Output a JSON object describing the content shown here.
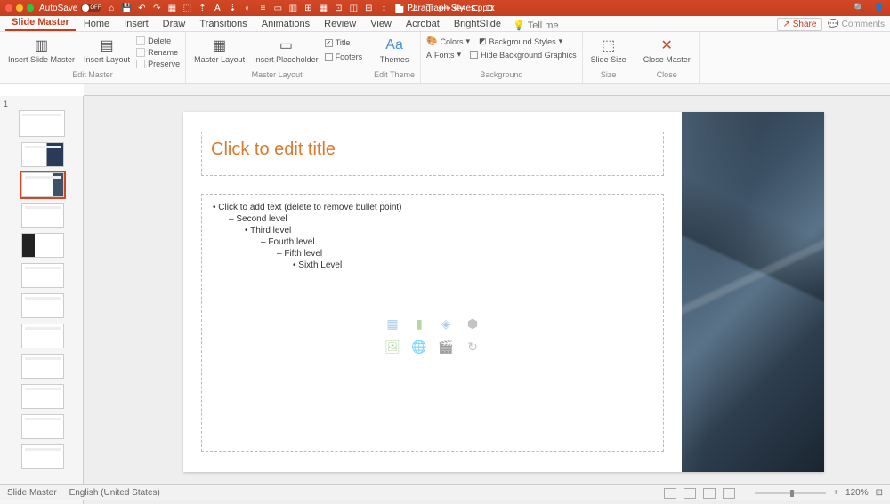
{
  "titlebar": {
    "autosave_label": "AutoSave",
    "autosave_state": "OFF",
    "filename": "Paragraph Styles.pptx"
  },
  "tabs": {
    "items": [
      "Slide Master",
      "Home",
      "Insert",
      "Draw",
      "Transitions",
      "Animations",
      "Review",
      "View",
      "Acrobat",
      "BrightSlide"
    ],
    "active": 0,
    "tellme": "Tell me",
    "share": "Share",
    "comments": "Comments"
  },
  "ribbon": {
    "edit_master": {
      "insert_slide_master": "Insert Slide Master",
      "insert_layout": "Insert Layout",
      "delete": "Delete",
      "rename": "Rename",
      "preserve": "Preserve",
      "group": "Edit Master"
    },
    "master_layout": {
      "master_layout": "Master Layout",
      "insert_placeholder": "Insert Placeholder",
      "title": "Title",
      "footers": "Footers",
      "group": "Master Layout"
    },
    "edit_theme": {
      "themes": "Themes",
      "group": "Edit Theme"
    },
    "background": {
      "colors": "Colors",
      "styles": "Background Styles",
      "fonts": "Fonts",
      "hide": "Hide Background Graphics",
      "group": "Background"
    },
    "size": {
      "slide_size": "Slide Size",
      "group": "Size"
    },
    "close": {
      "close_master": "Close Master",
      "group": "Close"
    }
  },
  "slide": {
    "title_placeholder": "Click to edit title",
    "body": {
      "l1": "Click to add text (delete to remove bullet point)",
      "l2": "Second level",
      "l3": "Third level",
      "l4": "Fourth level",
      "l5": "Fifth level",
      "l6": "Sixth Level"
    }
  },
  "status": {
    "view": "Slide Master",
    "lang": "English (United States)",
    "zoom": "120%"
  }
}
